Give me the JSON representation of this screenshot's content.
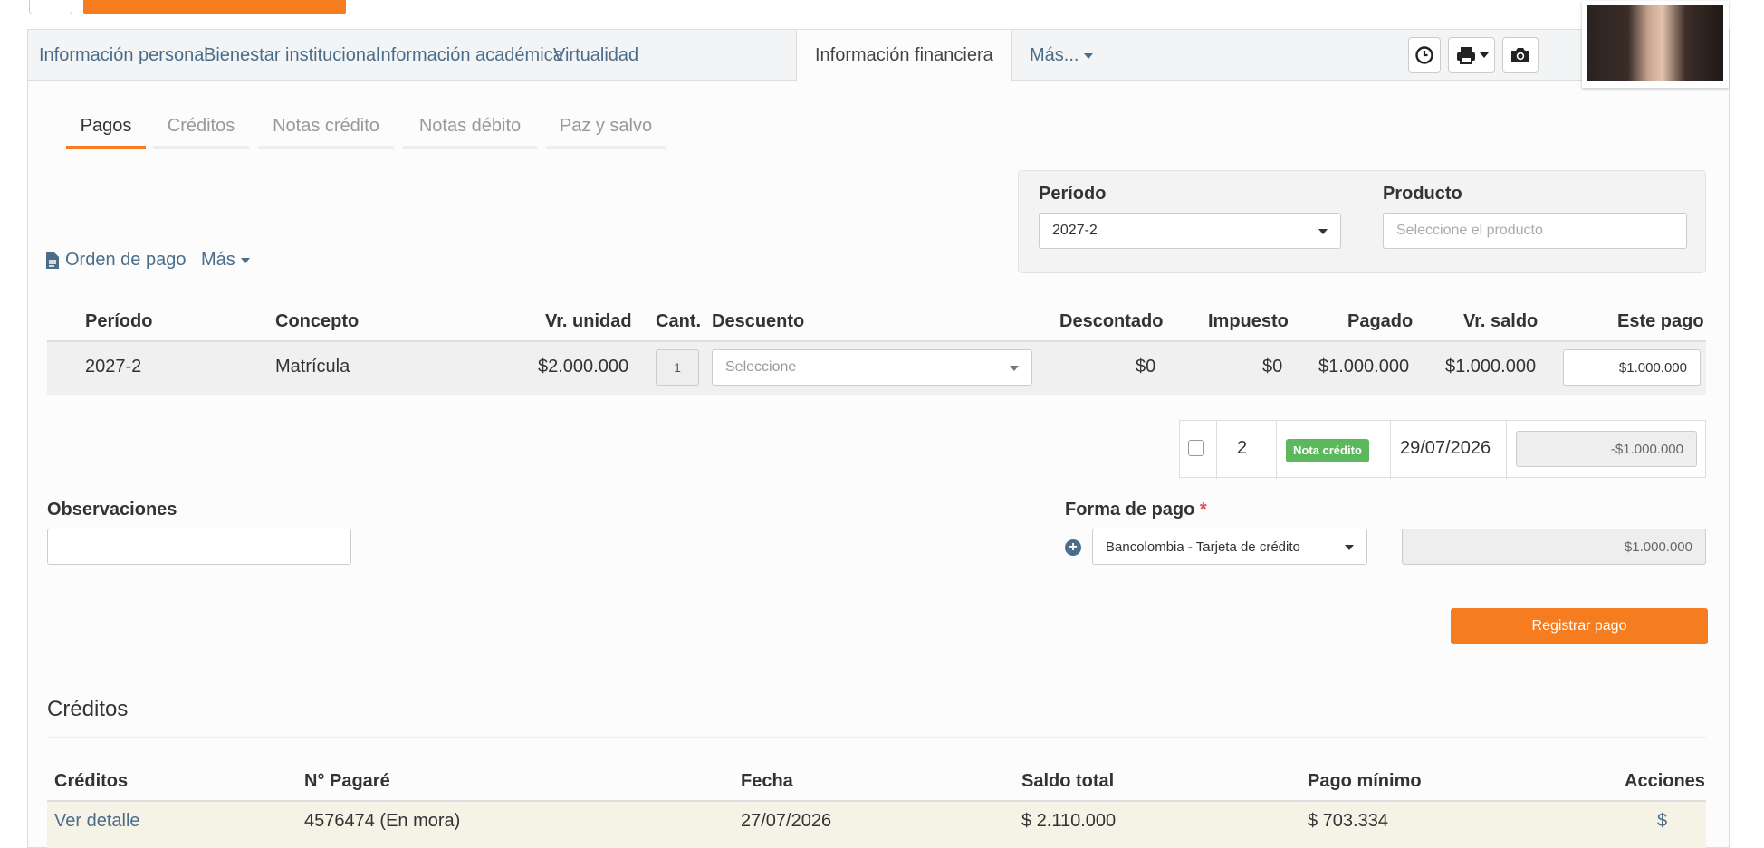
{
  "main_tabs": [
    {
      "label": "Información personal"
    },
    {
      "label": "Bienestar institucional"
    },
    {
      "label": "Información académica"
    },
    {
      "label": "Virtualidad"
    },
    {
      "label": "Información financiera"
    },
    {
      "label": "Más..."
    }
  ],
  "toolbar": {
    "icons": [
      "clock-icon",
      "print-icon",
      "camera-icon"
    ]
  },
  "sub_tabs": [
    {
      "label": "Pagos"
    },
    {
      "label": "Créditos"
    },
    {
      "label": "Notas crédito"
    },
    {
      "label": "Notas débito"
    },
    {
      "label": "Paz y salvo"
    }
  ],
  "filters": {
    "period_label": "Período",
    "period_value": "2027-2",
    "product_label": "Producto",
    "product_placeholder": "Seleccione el producto"
  },
  "actions": {
    "order_label": "Orden de pago",
    "more_label": "Más"
  },
  "table": {
    "headers": [
      "Período",
      "Concepto",
      "Vr. unidad",
      "Cant.",
      "Descuento",
      "Descontado",
      "Impuesto",
      "Pagado",
      "Vr. saldo",
      "Este pago"
    ],
    "row": {
      "period": "2027-2",
      "concept": "Matrícula",
      "unit_value": "$2.000.000",
      "qty": "1",
      "discount_placeholder": "Seleccione",
      "discounted": "$0",
      "tax": "$0",
      "paid": "$1.000.000",
      "balance": "$1.000.000",
      "this_payment": "$1.000.000"
    }
  },
  "credit_note": {
    "number": "2",
    "badge": "Nota crédito",
    "date": "29/07/2026",
    "amount": "-$1.000.000"
  },
  "observations": {
    "label": "Observaciones",
    "value": ""
  },
  "payment_method": {
    "label": "Forma de pago",
    "required_mark": "*",
    "value": "Bancolombia - Tarjeta de crédito",
    "amount": "$1.000.000"
  },
  "register_button": "Registrar pago",
  "credits": {
    "title": "Créditos",
    "headers": [
      "Créditos",
      "N° Pagaré",
      "Fecha",
      "Saldo total",
      "Pago mínimo",
      "Acciones"
    ],
    "row": {
      "link": "Ver detalle",
      "note_number": "4576474 (En mora)",
      "date": "27/07/2026",
      "total_balance": "$ 2.110.000",
      "min_payment": "$ 703.334",
      "action": "$"
    }
  },
  "colors": {
    "accent": "#f57c1f",
    "link": "#4b6d8a",
    "badge_green": "#5cb85c"
  }
}
